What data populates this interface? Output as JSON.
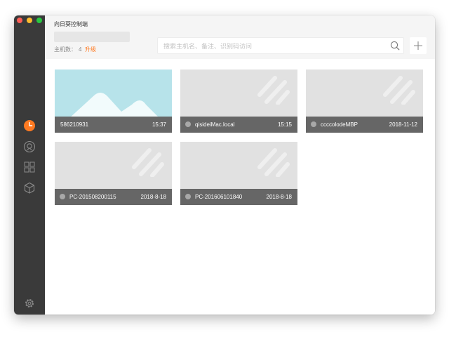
{
  "app": {
    "title": "向日葵控制端"
  },
  "header": {
    "host_count_label": "主机数：",
    "host_count": "4",
    "upgrade_label": "升级"
  },
  "search": {
    "placeholder": "搜索主机名、备注、识别码访问"
  },
  "sidebar": {
    "items": [
      {
        "name": "recent",
        "icon": "clock-icon",
        "active": true
      },
      {
        "name": "remote-assist",
        "icon": "remote-icon",
        "active": false
      },
      {
        "name": "devices",
        "icon": "grid-icon",
        "active": false
      },
      {
        "name": "plugins",
        "icon": "cube-icon",
        "active": false
      }
    ],
    "settings_icon": "gear-icon"
  },
  "colors": {
    "sidebar": "#3a3a3a",
    "accent": "#ff7a21",
    "card_footer": "#666666",
    "header": "#f5f5f5",
    "thumb_sky": "#b7e3ea"
  },
  "hosts": [
    {
      "name": "586210931",
      "time": "15:37",
      "thumbnail": "landscape",
      "status": "none"
    },
    {
      "name": "qisideiMac.local",
      "time": "15:15",
      "thumbnail": "placeholder",
      "status": "offline"
    },
    {
      "name": "ccccolodeMBP",
      "time": "2018-11-12",
      "thumbnail": "placeholder",
      "status": "offline"
    },
    {
      "name": "PC-201508200115",
      "time": "2018-8-18",
      "thumbnail": "placeholder",
      "status": "offline"
    },
    {
      "name": "PC-201606101840",
      "time": "2018-8-18",
      "thumbnail": "placeholder",
      "status": "offline"
    }
  ]
}
